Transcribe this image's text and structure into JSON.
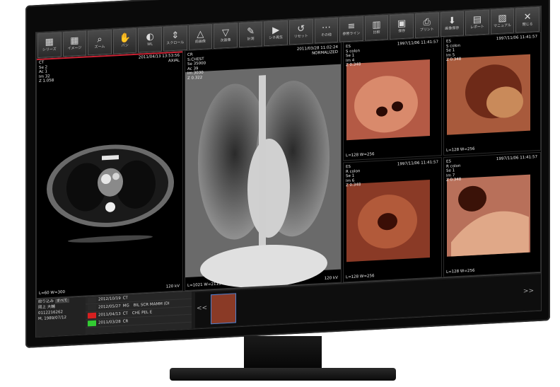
{
  "toolbar": {
    "items": [
      {
        "label": "シリーズ",
        "icon": "grid-icon"
      },
      {
        "label": "イメージ",
        "icon": "grid-icon"
      },
      {
        "label": "ズーム",
        "icon": "zoom-icon"
      },
      {
        "label": "パン",
        "icon": "hand-icon"
      },
      {
        "label": "WL",
        "icon": "contrast-icon"
      },
      {
        "label": "スクロール",
        "icon": "scroll-icon"
      },
      {
        "label": "前画像",
        "icon": "triangle-up-icon"
      },
      {
        "label": "次画像",
        "icon": "triangle-down-icon"
      },
      {
        "label": "計測",
        "icon": "ruler-icon"
      },
      {
        "label": "シネ再生",
        "icon": "play-icon"
      },
      {
        "label": "リセット",
        "icon": "reset-icon"
      },
      {
        "label": "その他",
        "icon": "more-icon"
      },
      {
        "label": "参照ライン",
        "icon": "lines-icon"
      },
      {
        "label": "比較",
        "icon": "compare-icon"
      },
      {
        "label": "保存",
        "icon": "save-icon"
      },
      {
        "label": "プリント",
        "icon": "print-icon"
      },
      {
        "label": "画像保存",
        "icon": "download-icon"
      },
      {
        "label": "レポート",
        "icon": "report-icon"
      },
      {
        "label": "マニュアル",
        "icon": "manual-icon"
      },
      {
        "label": "閉じる",
        "icon": "close-icon"
      }
    ]
  },
  "panes": {
    "ct": {
      "date": "2011/04/13 13:53:56",
      "orient": "AXIAL",
      "lines": "CT\nSe 2\nAc 1\nIm 32\nZ 1.058",
      "wl": "L=60 W=300",
      "kv": "120 kV"
    },
    "xray": {
      "date": "2011/03/28 11:02:24",
      "orient": "NORMALIZED",
      "lines": "CR\nS:CHEST\nSe 35000\nAc 39\nIm 3030\nZ 0.322",
      "wl": "L=1021 W=2115",
      "kv": "120 kV"
    },
    "endo": [
      {
        "date": "1997/11/06 11:41:57",
        "lines": "ES\nS colon\nSe 1\nIm 4\nZ 0.348",
        "wl": "L=128 W=256"
      },
      {
        "date": "1997/11/06 11:41:57",
        "lines": "ES\nS colon\nSe 1\nIm 5\nZ 0.348",
        "wl": "L=128 W=256"
      },
      {
        "date": "1997/11/06 11:41:57",
        "lines": "ES\nR colon\nSe 1\nIm 6\nZ 0.348",
        "wl": "L=128 W=256"
      },
      {
        "date": "1997/11/06 11:41:57",
        "lines": "ES\nR colon\nSe 1\nIm 7\nZ 0.348",
        "wl": "L=128 W=256"
      }
    ]
  },
  "patient": {
    "filter_label": "絞り込み",
    "filter_value": "すべて",
    "name": "岡上 大輔",
    "id": "0112216262",
    "sex_dob": "M, 1989/07/12"
  },
  "studies": [
    {
      "date": "2012/10/19",
      "mod": "CT",
      "desc": "",
      "color": "#2a2a2a"
    },
    {
      "date": "2012/05/27",
      "mod": "MG",
      "desc": "BIL SCR MAMM (DI",
      "color": "#2a2a2a"
    },
    {
      "date": "2011/04/13",
      "mod": "CT",
      "desc": "CHE PEL E",
      "color": "#d62020"
    },
    {
      "date": "2011/03/28",
      "mod": "CR",
      "desc": "",
      "color": "#33cc33"
    }
  ],
  "thumb_nav": {
    "prev": "<<",
    "next": ">>"
  }
}
